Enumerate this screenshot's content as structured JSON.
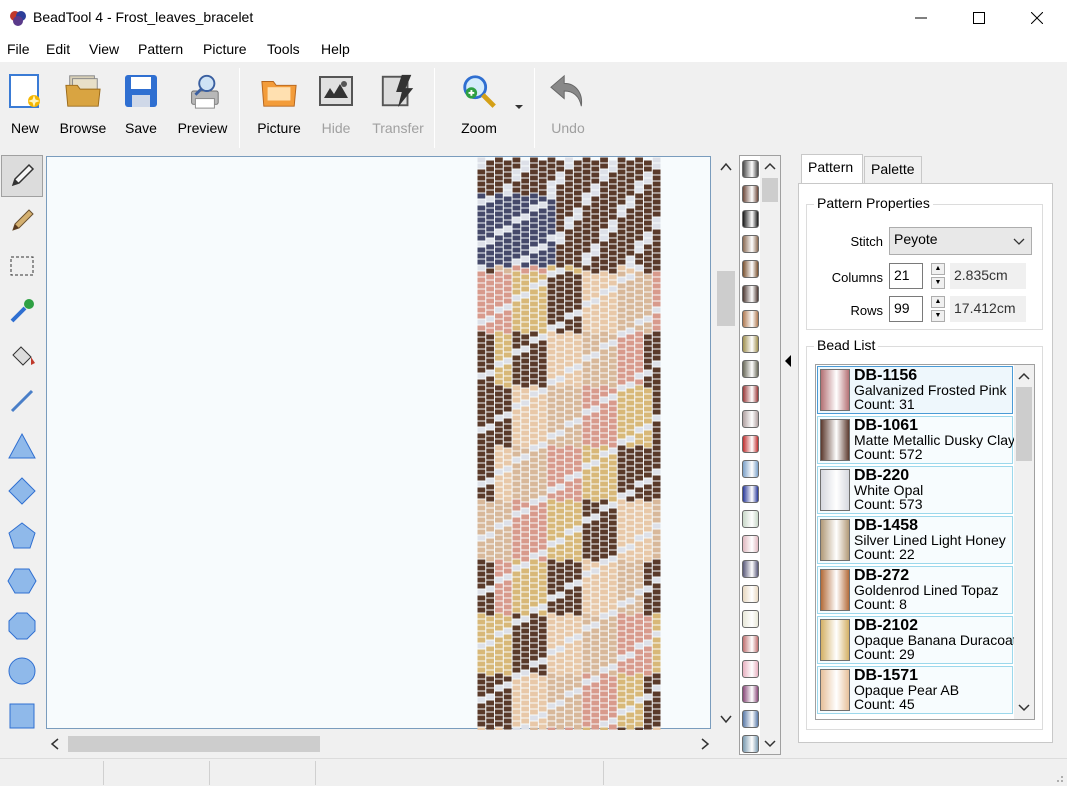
{
  "window": {
    "title": "BeadTool 4 - Frost_leaves_bracelet"
  },
  "menu": [
    "File",
    "Edit",
    "View",
    "Pattern",
    "Picture",
    "Tools",
    "Help"
  ],
  "toolbar": {
    "new": "New",
    "browse": "Browse",
    "save": "Save",
    "preview": "Preview",
    "picture": "Picture",
    "hide": "Hide",
    "transfer": "Transfer",
    "zoom": "Zoom",
    "undo": "Undo"
  },
  "tools": [
    "pencil",
    "pen",
    "rectangle-select",
    "eyedropper",
    "fill-bucket",
    "line",
    "triangle",
    "diamond",
    "pentagon",
    "hexagon",
    "octagon",
    "circle",
    "square"
  ],
  "tabs": {
    "pattern": "Pattern",
    "palette": "Palette"
  },
  "pattern_properties": {
    "title": "Pattern Properties",
    "stitch_label": "Stitch",
    "stitch_value": "Peyote",
    "columns_label": "Columns",
    "columns_value": "21",
    "columns_cm": "2.835cm",
    "rows_label": "Rows",
    "rows_value": "99",
    "rows_cm": "17.412cm"
  },
  "bead_list": {
    "title": "Bead List",
    "items": [
      {
        "code": "DB-1156",
        "name": "Galvanized Frosted Pink",
        "count": "Count: 31",
        "color": "#b47174"
      },
      {
        "code": "DB-1061",
        "name": "Matte Metallic Dusky Clay",
        "count": "Count: 572",
        "color": "#5c3a2e"
      },
      {
        "code": "DB-220",
        "name": "White Opal",
        "count": "Count: 573",
        "color": "#d6d8df"
      },
      {
        "code": "DB-1458",
        "name": "Silver Lined Light Honey",
        "count": "Count: 22",
        "color": "#b29a78"
      },
      {
        "code": "DB-272",
        "name": "Goldenrod Lined Topaz",
        "count": "Count: 8",
        "color": "#b46c3a"
      },
      {
        "code": "DB-2102",
        "name": "Opaque Banana Duracoat",
        "count": "Count: 29",
        "color": "#d4b065"
      },
      {
        "code": "DB-1571",
        "name": "Opaque Pear AB",
        "count": "Count: 45",
        "color": "#e6c09a"
      }
    ]
  },
  "palette_colors": [
    "#4a4a4a",
    "#6e4a3c",
    "#1a1a1a",
    "#8a6a52",
    "#7a5230",
    "#4e3a34",
    "#b07a52",
    "#a09050",
    "#6a6a5a",
    "#9a3a3a",
    "#b0a0a0",
    "#c03030",
    "#7aa0c8",
    "#2a3a9a",
    "#c8d8c8",
    "#e0b8c0",
    "#5a5a7a",
    "#e8d8c0",
    "#e8e8d8",
    "#c07070",
    "#e8b0c0",
    "#8a4a7a",
    "#5a7aa8",
    "#7a9ab0",
    "#a0a8b8"
  ],
  "pattern_colors": {
    "brown": "#5a3a2a",
    "white": "#dde0e8",
    "navy": "#45496a",
    "pink": "#d89a8c",
    "tan": "#d8b89a",
    "gold": "#d8b878",
    "rose": "#c8807a",
    "peach": "#e8c8a8"
  }
}
